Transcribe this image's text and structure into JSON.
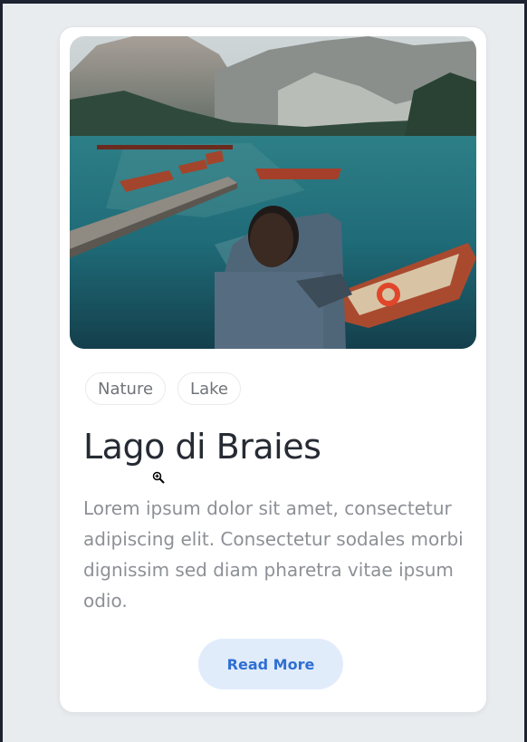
{
  "card": {
    "image_alt_icon": "lake-photo",
    "tags": [
      "Nature",
      "Lake"
    ],
    "title": "Lago di Braies",
    "description": "Lorem ipsum dolor sit amet, consectetur adipiscing elit. Consectetur sodales morbi dignissim sed diam pharetra vitae ipsum odio.",
    "button_label": "Read More"
  },
  "colors": {
    "page_background": "#e9ecef",
    "card_background": "#ffffff",
    "title": "#262b33",
    "description": "#8d9096",
    "button_background": "#e1ecfb",
    "button_text": "#2f6fd3"
  },
  "cursor_icon": "zoom-in-cursor-icon"
}
